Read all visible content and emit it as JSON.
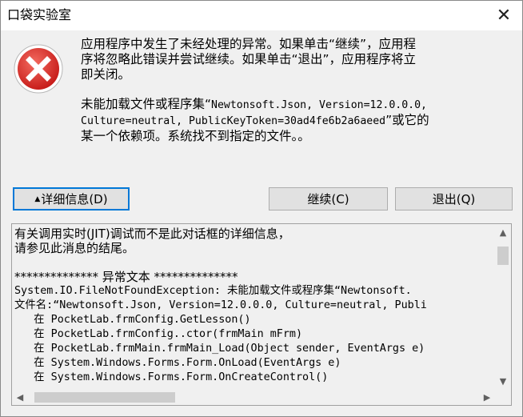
{
  "window": {
    "title": "口袋实验室",
    "close_glyph": "✕"
  },
  "icon": {
    "name": "error-icon",
    "color": "#d9302c"
  },
  "message": {
    "line1": "应用程序中发生了未经处理的异常。如果单击“继续”，应用程",
    "line2": "序将忽略此错误并尝试继续。如果单击“退出”，应用程序将立",
    "line3": "即关闭。",
    "detail_l1_prefix": "未能加载文件或程序集“",
    "detail_l1_mono": "Newtonsoft.Json, Version=12.0.0.0,",
    "detail_l2_mono": "Culture=neutral, PublicKeyToken=30ad4fe6b2a6aeed",
    "detail_l2_suffix": "”或它的",
    "detail_l3": "某一个依赖项。系统找不到指定的文件。。"
  },
  "buttons": {
    "details_label": "详细信息(D)",
    "details_glyph": "▲",
    "continue_label": "继续(C)",
    "quit_label": "退出(Q)"
  },
  "details": {
    "lines": [
      "有关调用实时(JIT)调试而不是此对话框的详细信息，",
      "请参见此消息的结尾。",
      "",
      "************** 异常文本 **************",
      "System.IO.FileNotFoundException: 未能加载文件或程序集“Newtonsoft.",
      "文件名:“Newtonsoft.Json, Version=12.0.0.0, Culture=neutral, Publi",
      "   在 PocketLab.frmConfig.GetLesson()",
      "   在 PocketLab.frmConfig..ctor(frmMain mFrm)",
      "   在 PocketLab.frmMain.frmMain_Load(Object sender, EventArgs e)",
      "   在 System.Windows.Forms.Form.OnLoad(EventArgs e)",
      "   在 System.Windows.Forms.Form.OnCreateControl()"
    ]
  },
  "scrollbars": {
    "up_glyph": "▲",
    "down_glyph": "▼",
    "left_glyph": "◀",
    "right_glyph": "▶"
  },
  "colors": {
    "focus_border": "#0078d7",
    "button_face": "#e1e1e1",
    "window_bg": "#f0f0f0"
  }
}
